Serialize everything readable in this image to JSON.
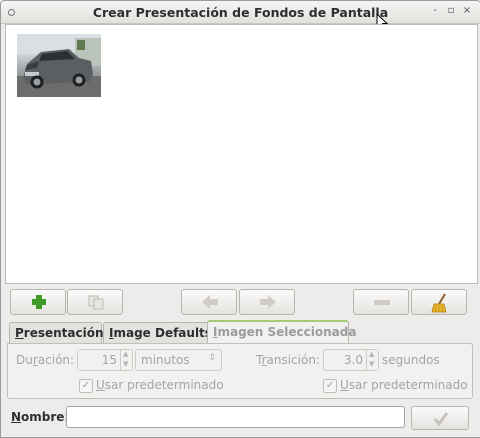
{
  "window": {
    "title": "Crear Presentación de Fondos de Pantalla",
    "controls": [
      "‹",
      "◦",
      "×"
    ]
  },
  "icon_view": {
    "items": [
      {
        "type": "image-thumbnail",
        "subject": "car-photo"
      }
    ]
  },
  "toolbar": {
    "buttons": [
      {
        "name": "add",
        "icon": "plus-icon",
        "enabled": true
      },
      {
        "name": "copy",
        "icon": "copy-icon",
        "enabled": false
      },
      {
        "name": "move-left",
        "icon": "arrow-left-icon",
        "enabled": false
      },
      {
        "name": "move-right",
        "icon": "arrow-right-icon",
        "enabled": false
      },
      {
        "name": "remove",
        "icon": "minus-icon",
        "enabled": false
      },
      {
        "name": "clear",
        "icon": "broom-icon",
        "enabled": true
      }
    ]
  },
  "tabs": [
    {
      "label_first": "P",
      "label_rest": "resentación",
      "active": false
    },
    {
      "label_first": "I",
      "label_rest": "mage Defaults",
      "active": false
    },
    {
      "label_first": "I",
      "label_rest": "magen Seleccionada",
      "active": true
    }
  ],
  "panel": {
    "duration_label_pre": "Du",
    "duration_label_acc": "r",
    "duration_label_post": "ación:",
    "duration_value": "15",
    "duration_unit": "minutos",
    "transition_label_pre": "T",
    "transition_label_acc": "r",
    "transition_label_post": "ansición:",
    "transition_value": "3.0",
    "transition_unit": "segundos",
    "use_default_1_acc": "U",
    "use_default_1_rest": "sar predeterminado",
    "use_default_2_acc": "U",
    "use_default_2_rest": "sar predeterminado",
    "check_mark": "✓"
  },
  "name_row": {
    "label_acc": "N",
    "label_rest": "ombre:",
    "value": "",
    "ok_icon": "checkmark-icon"
  },
  "colors": {
    "accent_tab": "#a6c97a",
    "plus_green": "#3f9b25",
    "disabled_text": "#a4a4a4"
  }
}
